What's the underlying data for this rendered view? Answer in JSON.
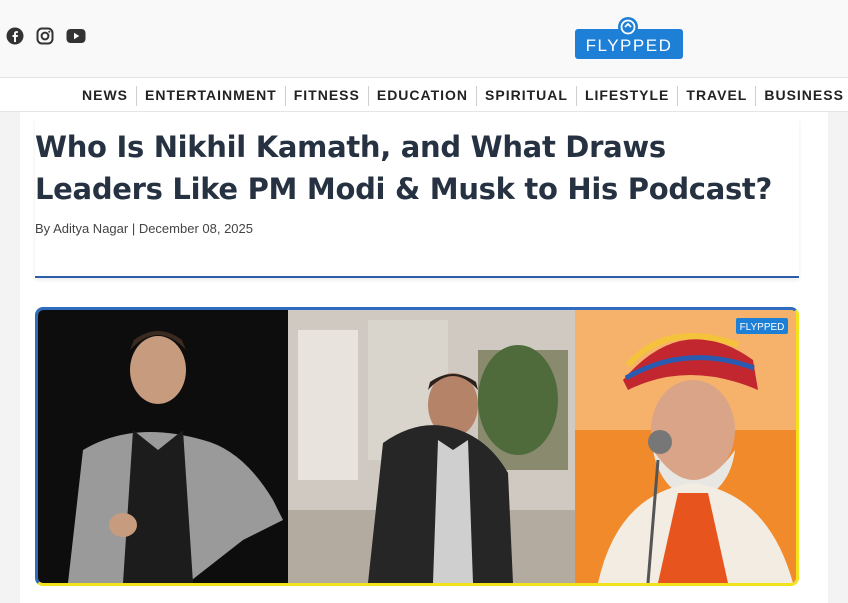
{
  "social": {
    "icons": [
      "facebook-icon",
      "instagram-icon",
      "youtube-icon"
    ]
  },
  "brand": {
    "logo_text": "FLYPPED",
    "logo_color": "#1e7fd6"
  },
  "nav": {
    "items": [
      "NEWS",
      "ENTERTAINMENT",
      "FITNESS",
      "EDUCATION",
      "SPIRITUAL",
      "LIFESTYLE",
      "TRAVEL",
      "BUSINESS"
    ]
  },
  "article": {
    "title": "Who Is Nikhil Kamath, and What Draws Leaders Like PM Modi & Musk to His Podcast?",
    "meta": "By Aditya Nagar | December 08, 2025",
    "accent_color": "#2a5fa8"
  },
  "hero": {
    "watermark": "FLYPPED"
  }
}
